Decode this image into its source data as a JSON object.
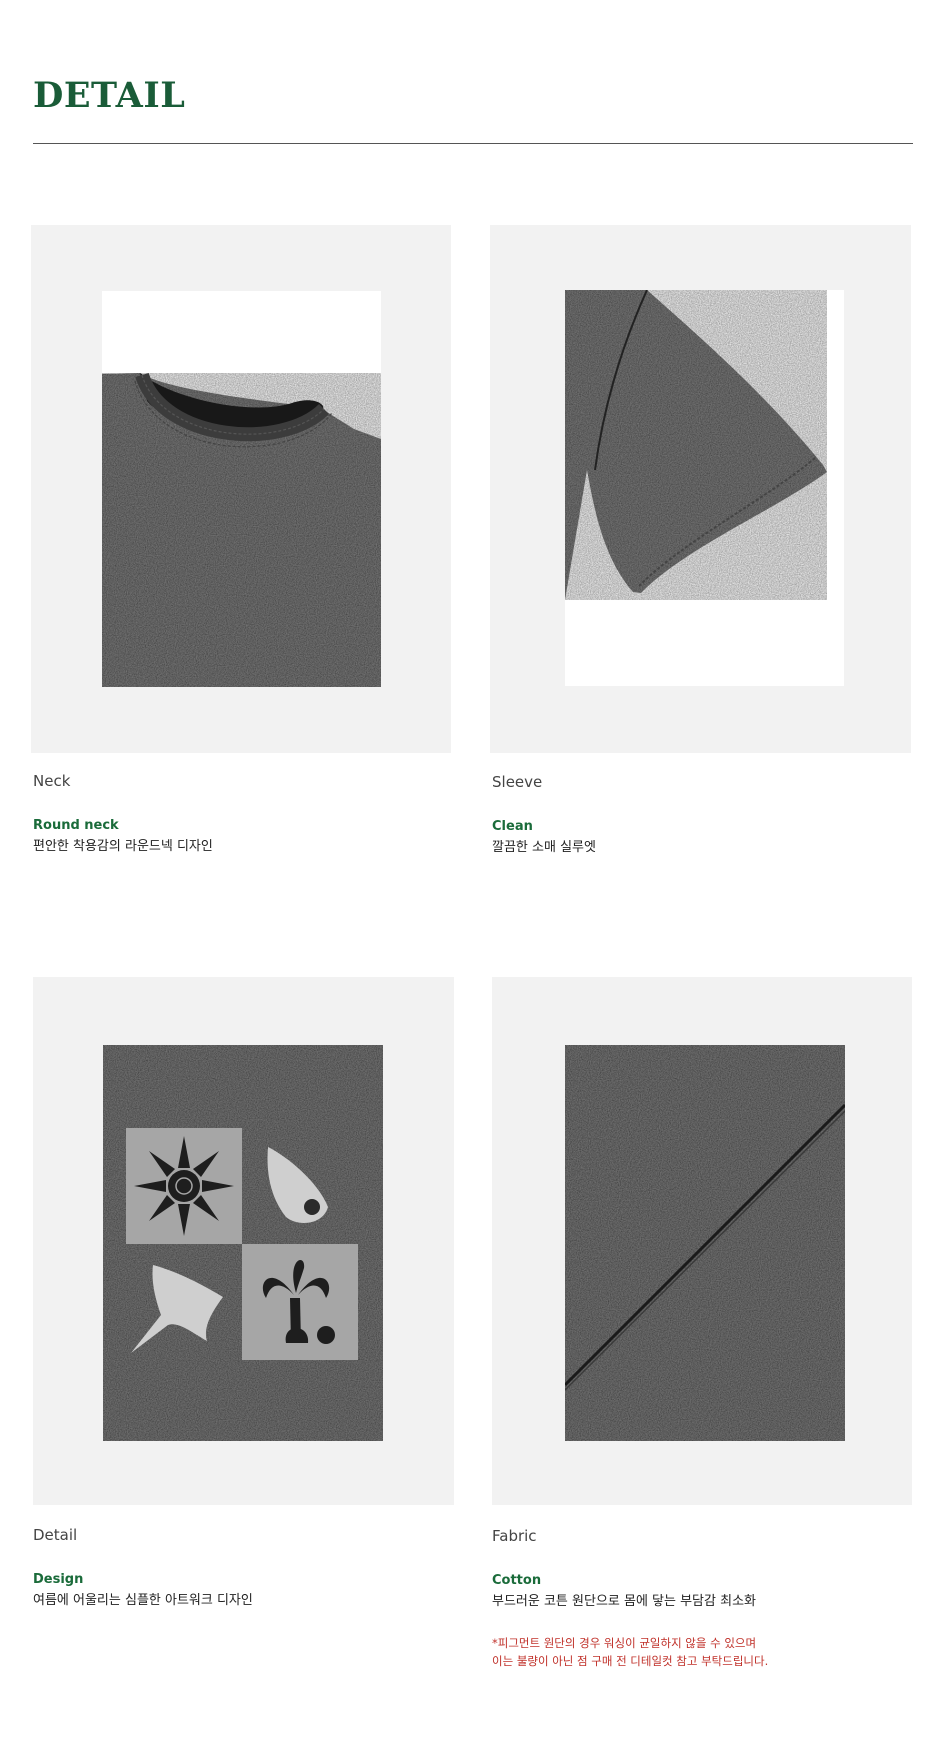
{
  "page": {
    "title": "DETAIL"
  },
  "details": [
    {
      "label": "Neck",
      "subtitle": "Round neck",
      "description": "편안한 착용감의 라운드넥 디자인"
    },
    {
      "label": "Sleeve",
      "subtitle": "Clean",
      "description": "깔끔한 소매 실루엣"
    },
    {
      "label": "Detail",
      "subtitle": "Design",
      "description": "여름에 어울리는 심플한 아트워크 디자인"
    },
    {
      "label": "Fabric",
      "subtitle": "Cotton",
      "description": "부드러운 코튼 원단으로 몸에 닿는 부담감 최소화"
    }
  ],
  "fabric_note": {
    "line1": "*피그먼트 원단의 경우 워싱이 균일하지 않을 수 있으며",
    "line2": "이는 불량이 아닌 점 구매 전 디테일컷 참고 부탁드립니다."
  },
  "colors": {
    "title_green": "#1a5c38",
    "subtitle_green": "#1a6b3a",
    "note_red": "#c0312a",
    "card_bg": "#f2f2f2",
    "fabric_dark": "#2b2b2b"
  }
}
